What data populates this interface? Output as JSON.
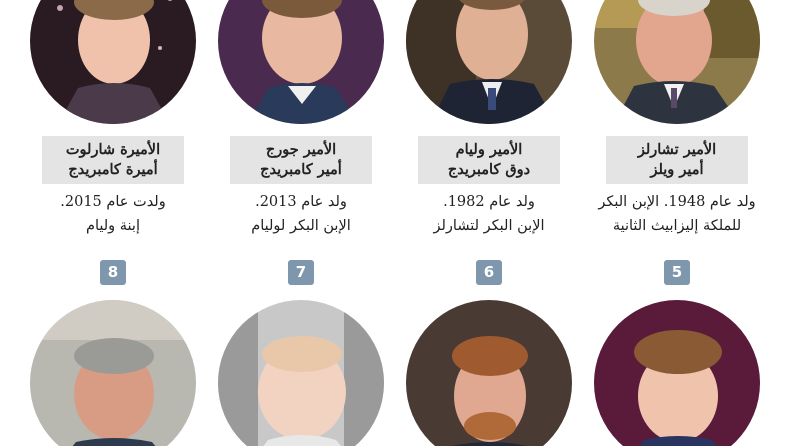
{
  "people": [
    {
      "name_line1": "الأمير تشارلز",
      "name_line2": "أمير ويلز",
      "desc_line1": "ولد عام 1948. الإبن البكر",
      "desc_line2": "للملكة إليزابيث الثانية"
    },
    {
      "name_line1": "الأمير وليام",
      "name_line2": "دوق كامبريدج",
      "desc_line1": "ولد عام 1982.",
      "desc_line2": "الإبن البكر لتشارلز"
    },
    {
      "name_line1": "الأمير جورج",
      "name_line2": "أمير كامبريدج",
      "desc_line1": "ولد عام 2013.",
      "desc_line2": "الإبن البكر لوليام"
    },
    {
      "name_line1": "الأميرة شارلوت",
      "name_line2": "أميرة كامبريدج",
      "desc_line1": "ولدت عام 2015.",
      "desc_line2": "إبنة وليام"
    }
  ],
  "numbers": [
    "5",
    "6",
    "7",
    "8"
  ],
  "colors": {
    "badge": "#7e97ac",
    "name_box": "#e4e4e4"
  },
  "portraits_bottom": [
    "photo-prince-louis",
    "photo-prince-harry",
    "photo-archie",
    "photo-prince-andrew"
  ]
}
